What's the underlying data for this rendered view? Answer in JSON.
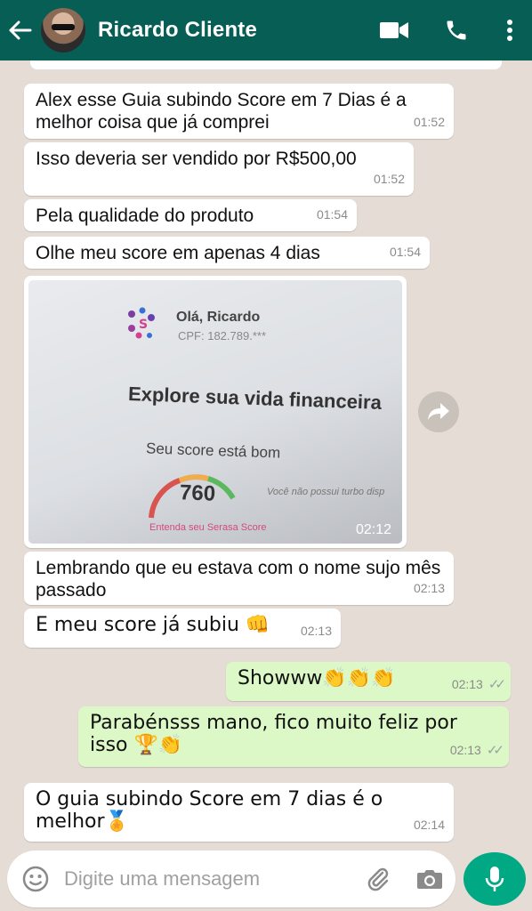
{
  "header": {
    "contact_name": "Ricardo Cliente"
  },
  "messages": [
    {
      "text": "Alex esse Guia subindo Score em 7 Dias é a melhor coisa que já comprei",
      "time": "01:52"
    },
    {
      "text": "Isso deveria ser vendido por R$500,00",
      "time": "01:52"
    },
    {
      "text": "Pela qualidade do produto",
      "time": "01:54"
    },
    {
      "text": "Olhe meu score em apenas 4 dias",
      "time": "01:54"
    },
    {
      "text": "Lembrando que eu estava com o nome sujo mês passado",
      "time": "02:13"
    },
    {
      "text": "E meu score já subiu 👊",
      "time": "02:13"
    },
    {
      "text": "Showww👏👏👏",
      "time": "02:13"
    },
    {
      "text": "Parabénsss mano, fico muito feliz por isso 🏆👏",
      "time": "02:13"
    },
    {
      "text": "O guia subindo Score em 7 dias é o melhor🏅",
      "time": "02:14"
    }
  ],
  "photo": {
    "greeting": "Olá, Ricardo",
    "cpf": "CPF: 182.789.***",
    "headline": "Explore sua vida financeira",
    "score_label": "Seu score está bom",
    "score": "760",
    "turbo": "Você não possui turbo disp",
    "link": "Entenda seu Serasa Score",
    "time": "02:12"
  },
  "input": {
    "placeholder": "Digite uma mensagem"
  },
  "colors": {
    "header": "#075e54",
    "outgoing_bubble": "#dcf8c6",
    "incoming_bubble": "#ffffff",
    "background": "#e5ddd5",
    "mic_button": "#00a884"
  }
}
